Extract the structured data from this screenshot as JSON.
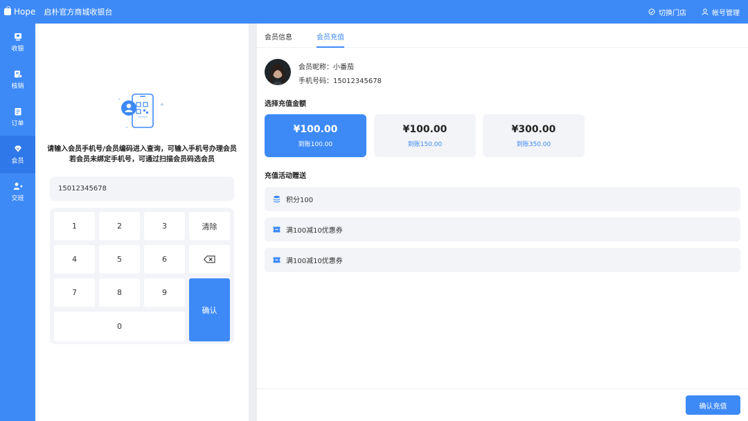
{
  "header": {
    "brand": "Hope",
    "title": "启朴官方商城收银台",
    "switch_store": "切换门店",
    "account": "帐号管理"
  },
  "sidebar": {
    "items": [
      {
        "label": "收银",
        "icon": "cashier-icon"
      },
      {
        "label": "核销",
        "icon": "verify-icon"
      },
      {
        "label": "订单",
        "icon": "order-icon"
      },
      {
        "label": "会员",
        "icon": "member-icon",
        "active": true
      },
      {
        "label": "交班",
        "icon": "shift-icon"
      }
    ]
  },
  "lookup": {
    "hint_line1": "请输入会员手机号/会员编码进入查询，可输入手机号办理会员",
    "hint_line2": "若会员未绑定手机号，可通过扫描会员码选会员",
    "phone_value": "15012345678",
    "keys": {
      "k1": "1",
      "k2": "2",
      "k3": "3",
      "clear": "清除",
      "k4": "4",
      "k5": "5",
      "k6": "6",
      "k7": "7",
      "k8": "8",
      "k9": "9",
      "k0": "0",
      "confirm": "确认"
    }
  },
  "tabs": {
    "info": "会员信息",
    "recharge": "会员充值",
    "active": "recharge"
  },
  "member": {
    "nickname": "会员昵称：小番茄",
    "phone": "手机号码：15012345678"
  },
  "recharge": {
    "amount_label": "选择充值金额",
    "options": [
      {
        "price": "¥100.00",
        "bonus": "到账100.00",
        "selected": true
      },
      {
        "price": "¥100.00",
        "bonus": "到账150.00",
        "selected": false
      },
      {
        "price": "¥300.00",
        "bonus": "到账350.00",
        "selected": false
      }
    ],
    "gift_label": "充值活动赠送",
    "gifts": [
      {
        "text": "积分100",
        "icon": "coins-icon"
      },
      {
        "text": "满100减10优惠券",
        "icon": "coupon-icon"
      },
      {
        "text": "满100减10优惠券",
        "icon": "coupon-icon"
      }
    ],
    "submit": "确认充值"
  },
  "colors": {
    "primary": "#3d8af7",
    "panel_bg": "#f3f4f7"
  }
}
